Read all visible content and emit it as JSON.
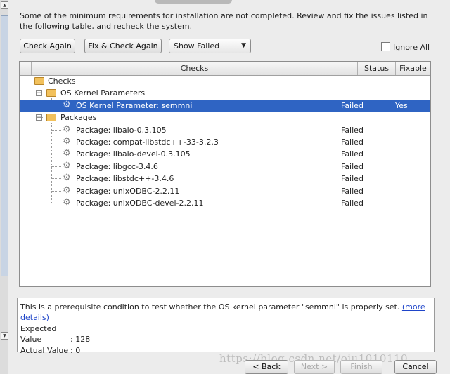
{
  "intro_text": "Some of the minimum requirements for installation are not completed. Review and fix the issues listed in the following table, and recheck the system.",
  "toolbar": {
    "check_again_label": "Check Again",
    "fix_check_again_label": "Fix & Check Again",
    "show_filter_value": "Show Failed",
    "ignore_all_label": "Ignore All"
  },
  "table": {
    "columns": [
      "Checks",
      "Status",
      "Fixable"
    ],
    "root_label": "Checks",
    "groups": [
      {
        "label": "OS Kernel Parameters",
        "items": [
          {
            "name": "OS Kernel Parameter: semmni",
            "status": "Failed",
            "fixable": "Yes"
          }
        ]
      },
      {
        "label": "Packages",
        "items": [
          {
            "name": "Package: libaio-0.3.105",
            "status": "Failed",
            "fixable": ""
          },
          {
            "name": "Package: compat-libstdc++-33-3.2.3",
            "status": "Failed",
            "fixable": ""
          },
          {
            "name": "Package: libaio-devel-0.3.105",
            "status": "Failed",
            "fixable": ""
          },
          {
            "name": "Package: libgcc-3.4.6",
            "status": "Failed",
            "fixable": ""
          },
          {
            "name": "Package: libstdc++-3.4.6",
            "status": "Failed",
            "fixable": ""
          },
          {
            "name": "Package: unixODBC-2.2.11",
            "status": "Failed",
            "fixable": ""
          },
          {
            "name": "Package: unixODBC-devel-2.2.11",
            "status": "Failed",
            "fixable": ""
          }
        ]
      }
    ]
  },
  "details": {
    "description": "This is a prerequisite condition to test whether the OS kernel parameter \"semmni\" is properly set.",
    "more_link": "(more details)",
    "expected_label": "Expected Value",
    "expected_value": ": 128",
    "actual_label": "Actual Value",
    "actual_value": ": 0"
  },
  "footer": {
    "back_label": "< Back",
    "next_label": "Next >",
    "finish_label": "Finish",
    "cancel_label": "Cancel",
    "watermark": "https://blog.csdn.net/oiu1010110"
  }
}
